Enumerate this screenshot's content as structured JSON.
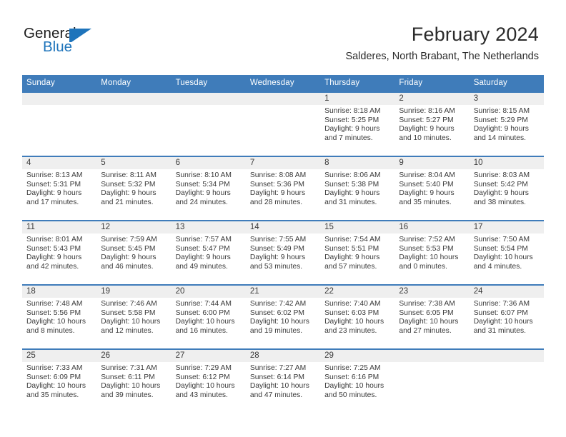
{
  "brand": {
    "name_part1": "General",
    "name_part2": "Blue",
    "accent_color": "#1e74bb"
  },
  "header": {
    "month_title": "February 2024",
    "location": "Salderes, North Brabant, The Netherlands"
  },
  "theme": {
    "header_blue": "#3f7cba",
    "daynum_band": "#efefef",
    "text": "#3a3a3a"
  },
  "weekday_headers": [
    "Sunday",
    "Monday",
    "Tuesday",
    "Wednesday",
    "Thursday",
    "Friday",
    "Saturday"
  ],
  "labels": {
    "sunrise_prefix": "Sunrise:",
    "sunset_prefix": "Sunset:",
    "daylight_prefix": "Daylight:"
  },
  "weeks": [
    [
      {
        "day": "",
        "empty": true,
        "sunrise": "",
        "sunset": "",
        "daylight_line1": "",
        "daylight_line2": ""
      },
      {
        "day": "",
        "empty": true,
        "sunrise": "",
        "sunset": "",
        "daylight_line1": "",
        "daylight_line2": ""
      },
      {
        "day": "",
        "empty": true,
        "sunrise": "",
        "sunset": "",
        "daylight_line1": "",
        "daylight_line2": ""
      },
      {
        "day": "",
        "empty": true,
        "sunrise": "",
        "sunset": "",
        "daylight_line1": "",
        "daylight_line2": ""
      },
      {
        "day": "1",
        "empty": false,
        "sunrise": "Sunrise: 8:18 AM",
        "sunset": "Sunset: 5:25 PM",
        "daylight_line1": "Daylight: 9 hours",
        "daylight_line2": "and 7 minutes."
      },
      {
        "day": "2",
        "empty": false,
        "sunrise": "Sunrise: 8:16 AM",
        "sunset": "Sunset: 5:27 PM",
        "daylight_line1": "Daylight: 9 hours",
        "daylight_line2": "and 10 minutes."
      },
      {
        "day": "3",
        "empty": false,
        "sunrise": "Sunrise: 8:15 AM",
        "sunset": "Sunset: 5:29 PM",
        "daylight_line1": "Daylight: 9 hours",
        "daylight_line2": "and 14 minutes."
      }
    ],
    [
      {
        "day": "4",
        "empty": false,
        "sunrise": "Sunrise: 8:13 AM",
        "sunset": "Sunset: 5:31 PM",
        "daylight_line1": "Daylight: 9 hours",
        "daylight_line2": "and 17 minutes."
      },
      {
        "day": "5",
        "empty": false,
        "sunrise": "Sunrise: 8:11 AM",
        "sunset": "Sunset: 5:32 PM",
        "daylight_line1": "Daylight: 9 hours",
        "daylight_line2": "and 21 minutes."
      },
      {
        "day": "6",
        "empty": false,
        "sunrise": "Sunrise: 8:10 AM",
        "sunset": "Sunset: 5:34 PM",
        "daylight_line1": "Daylight: 9 hours",
        "daylight_line2": "and 24 minutes."
      },
      {
        "day": "7",
        "empty": false,
        "sunrise": "Sunrise: 8:08 AM",
        "sunset": "Sunset: 5:36 PM",
        "daylight_line1": "Daylight: 9 hours",
        "daylight_line2": "and 28 minutes."
      },
      {
        "day": "8",
        "empty": false,
        "sunrise": "Sunrise: 8:06 AM",
        "sunset": "Sunset: 5:38 PM",
        "daylight_line1": "Daylight: 9 hours",
        "daylight_line2": "and 31 minutes."
      },
      {
        "day": "9",
        "empty": false,
        "sunrise": "Sunrise: 8:04 AM",
        "sunset": "Sunset: 5:40 PM",
        "daylight_line1": "Daylight: 9 hours",
        "daylight_line2": "and 35 minutes."
      },
      {
        "day": "10",
        "empty": false,
        "sunrise": "Sunrise: 8:03 AM",
        "sunset": "Sunset: 5:42 PM",
        "daylight_line1": "Daylight: 9 hours",
        "daylight_line2": "and 38 minutes."
      }
    ],
    [
      {
        "day": "11",
        "empty": false,
        "sunrise": "Sunrise: 8:01 AM",
        "sunset": "Sunset: 5:43 PM",
        "daylight_line1": "Daylight: 9 hours",
        "daylight_line2": "and 42 minutes."
      },
      {
        "day": "12",
        "empty": false,
        "sunrise": "Sunrise: 7:59 AM",
        "sunset": "Sunset: 5:45 PM",
        "daylight_line1": "Daylight: 9 hours",
        "daylight_line2": "and 46 minutes."
      },
      {
        "day": "13",
        "empty": false,
        "sunrise": "Sunrise: 7:57 AM",
        "sunset": "Sunset: 5:47 PM",
        "daylight_line1": "Daylight: 9 hours",
        "daylight_line2": "and 49 minutes."
      },
      {
        "day": "14",
        "empty": false,
        "sunrise": "Sunrise: 7:55 AM",
        "sunset": "Sunset: 5:49 PM",
        "daylight_line1": "Daylight: 9 hours",
        "daylight_line2": "and 53 minutes."
      },
      {
        "day": "15",
        "empty": false,
        "sunrise": "Sunrise: 7:54 AM",
        "sunset": "Sunset: 5:51 PM",
        "daylight_line1": "Daylight: 9 hours",
        "daylight_line2": "and 57 minutes."
      },
      {
        "day": "16",
        "empty": false,
        "sunrise": "Sunrise: 7:52 AM",
        "sunset": "Sunset: 5:53 PM",
        "daylight_line1": "Daylight: 10 hours",
        "daylight_line2": "and 0 minutes."
      },
      {
        "day": "17",
        "empty": false,
        "sunrise": "Sunrise: 7:50 AM",
        "sunset": "Sunset: 5:54 PM",
        "daylight_line1": "Daylight: 10 hours",
        "daylight_line2": "and 4 minutes."
      }
    ],
    [
      {
        "day": "18",
        "empty": false,
        "sunrise": "Sunrise: 7:48 AM",
        "sunset": "Sunset: 5:56 PM",
        "daylight_line1": "Daylight: 10 hours",
        "daylight_line2": "and 8 minutes."
      },
      {
        "day": "19",
        "empty": false,
        "sunrise": "Sunrise: 7:46 AM",
        "sunset": "Sunset: 5:58 PM",
        "daylight_line1": "Daylight: 10 hours",
        "daylight_line2": "and 12 minutes."
      },
      {
        "day": "20",
        "empty": false,
        "sunrise": "Sunrise: 7:44 AM",
        "sunset": "Sunset: 6:00 PM",
        "daylight_line1": "Daylight: 10 hours",
        "daylight_line2": "and 16 minutes."
      },
      {
        "day": "21",
        "empty": false,
        "sunrise": "Sunrise: 7:42 AM",
        "sunset": "Sunset: 6:02 PM",
        "daylight_line1": "Daylight: 10 hours",
        "daylight_line2": "and 19 minutes."
      },
      {
        "day": "22",
        "empty": false,
        "sunrise": "Sunrise: 7:40 AM",
        "sunset": "Sunset: 6:03 PM",
        "daylight_line1": "Daylight: 10 hours",
        "daylight_line2": "and 23 minutes."
      },
      {
        "day": "23",
        "empty": false,
        "sunrise": "Sunrise: 7:38 AM",
        "sunset": "Sunset: 6:05 PM",
        "daylight_line1": "Daylight: 10 hours",
        "daylight_line2": "and 27 minutes."
      },
      {
        "day": "24",
        "empty": false,
        "sunrise": "Sunrise: 7:36 AM",
        "sunset": "Sunset: 6:07 PM",
        "daylight_line1": "Daylight: 10 hours",
        "daylight_line2": "and 31 minutes."
      }
    ],
    [
      {
        "day": "25",
        "empty": false,
        "sunrise": "Sunrise: 7:33 AM",
        "sunset": "Sunset: 6:09 PM",
        "daylight_line1": "Daylight: 10 hours",
        "daylight_line2": "and 35 minutes."
      },
      {
        "day": "26",
        "empty": false,
        "sunrise": "Sunrise: 7:31 AM",
        "sunset": "Sunset: 6:11 PM",
        "daylight_line1": "Daylight: 10 hours",
        "daylight_line2": "and 39 minutes."
      },
      {
        "day": "27",
        "empty": false,
        "sunrise": "Sunrise: 7:29 AM",
        "sunset": "Sunset: 6:12 PM",
        "daylight_line1": "Daylight: 10 hours",
        "daylight_line2": "and 43 minutes."
      },
      {
        "day": "28",
        "empty": false,
        "sunrise": "Sunrise: 7:27 AM",
        "sunset": "Sunset: 6:14 PM",
        "daylight_line1": "Daylight: 10 hours",
        "daylight_line2": "and 47 minutes."
      },
      {
        "day": "29",
        "empty": false,
        "sunrise": "Sunrise: 7:25 AM",
        "sunset": "Sunset: 6:16 PM",
        "daylight_line1": "Daylight: 10 hours",
        "daylight_line2": "and 50 minutes."
      },
      {
        "day": "",
        "empty": true,
        "sunrise": "",
        "sunset": "",
        "daylight_line1": "",
        "daylight_line2": ""
      },
      {
        "day": "",
        "empty": true,
        "sunrise": "",
        "sunset": "",
        "daylight_line1": "",
        "daylight_line2": ""
      }
    ]
  ]
}
